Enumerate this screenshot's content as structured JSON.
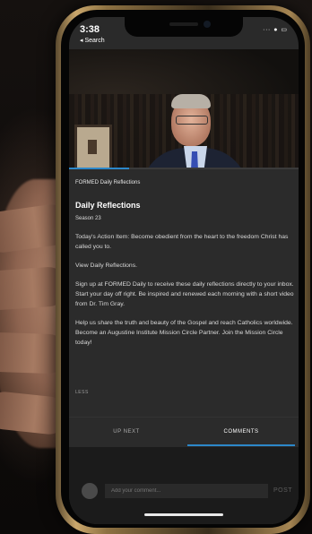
{
  "status_bar": {
    "time": "3:38",
    "back_label": "◂ Search",
    "icons": "∙∙∙ ● ▭"
  },
  "video": {
    "progress_fraction": 0.26,
    "accent_color": "#2c87c9"
  },
  "episode": {
    "source_label": "FORMED Daily Reflections",
    "title": "Daily Reflections",
    "season": "Season 23",
    "paragraphs": [
      "Today's Action Item: Become obedient from the heart to the freedom Christ has called you to.",
      "View Daily Reflections.",
      "Sign up at FORMED Daily to receive these daily reflections directly to your inbox.\nStart your day off right. Be inspired and renewed each morning with a short video from Dr. Tim Gray.",
      "Help us share the truth and beauty of the Gospel and reach Catholics worldwide. Become an Augustine Institute Mission Circle Partner. Join the Mission Circle today!"
    ],
    "less_label": "LESS"
  },
  "tabs": {
    "up_next": "UP NEXT",
    "comments": "COMMENTS",
    "active": "comments"
  },
  "composer": {
    "placeholder": "Add your comment...",
    "post_label": "POST"
  }
}
